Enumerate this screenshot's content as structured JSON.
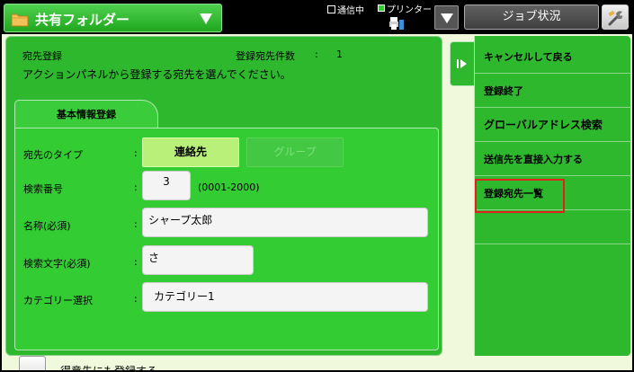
{
  "header": {
    "folder_label": "共有フォルダー",
    "comm_status": "通信中",
    "printer_status": "プリンター",
    "job_status_label": "ジョブ状況"
  },
  "main": {
    "title": "宛先登録",
    "count_label": "登録宛先件数",
    "count_colon": ":",
    "count_value": "1",
    "instruction": "アクションパネルから登録する宛先を選んでください。",
    "tab_label": "基本情報登録"
  },
  "form": {
    "colon": ":",
    "type": {
      "label": "宛先のタイプ",
      "option_contact": "連絡先",
      "option_group": "グループ"
    },
    "search_no": {
      "label": "検索番号",
      "value": "3",
      "range_hint": "(0001-2000)"
    },
    "name": {
      "label": "名称(必須)",
      "value": "シャープ太郎"
    },
    "search_text": {
      "label": "検索文字(必須)",
      "value": "さ"
    },
    "category": {
      "label": "カテゴリー選択",
      "value": "カテゴリー1"
    },
    "favorite": {
      "label": "得意先にも登録する"
    }
  },
  "side_panel": {
    "items": [
      {
        "label": "キャンセルして戻る"
      },
      {
        "label": "登録終了"
      },
      {
        "label": "グローバルアドレス検索"
      },
      {
        "label": "送信先を直接入力する"
      },
      {
        "label": "登録宛先一覧"
      }
    ]
  },
  "colors": {
    "panel_green": "#2eb82e",
    "form_green": "#33cc33",
    "selected_option": "#b8f07a",
    "highlight_red": "#e4201c",
    "background": "#f0f9dc"
  },
  "icons": {
    "folder": "folder-icon",
    "dropdown": "chevron-down-icon",
    "printer": "printer-icon",
    "tool": "tool-icon",
    "expand": "play-arrow-icon"
  }
}
